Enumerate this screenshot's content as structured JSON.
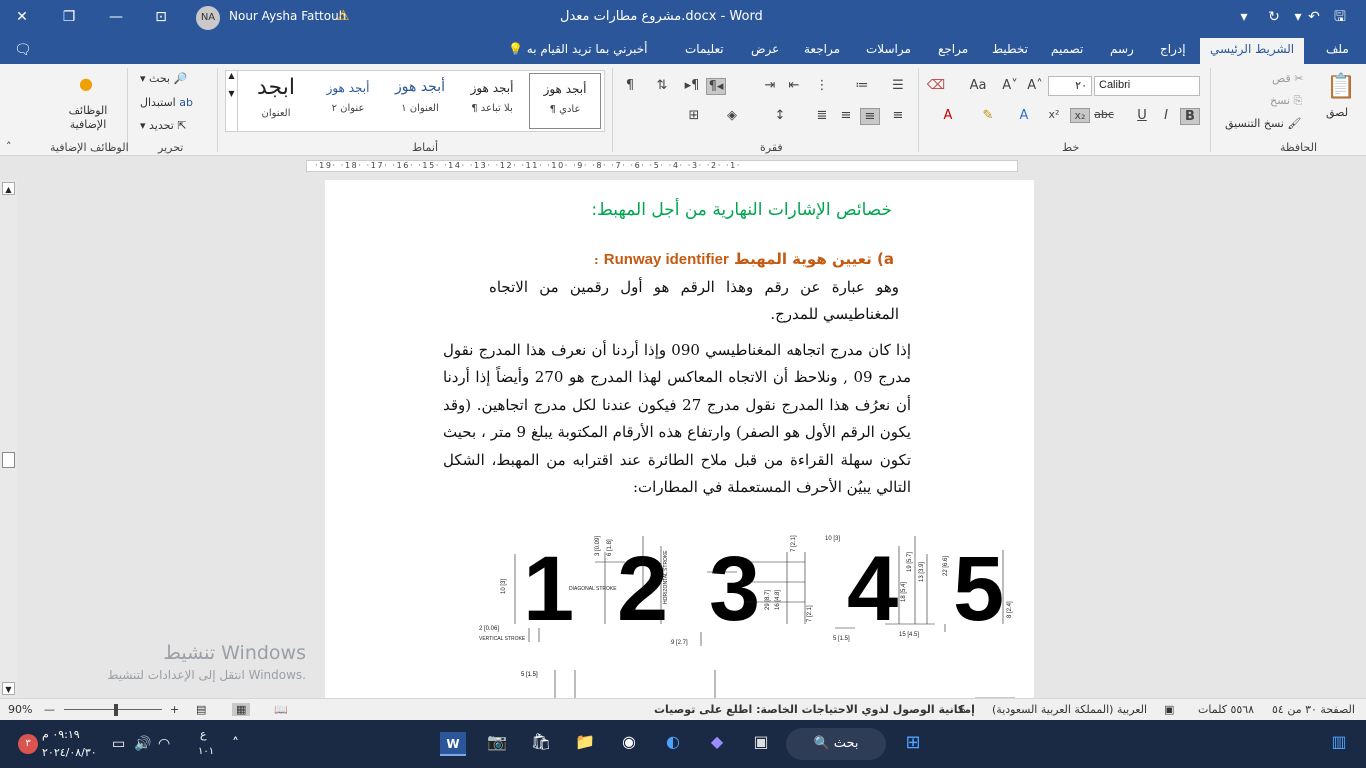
{
  "titlebar": {
    "title": "مشروع مطارات معدل.docx  -  Word",
    "user": "Nour Aysha Fattouh",
    "avatar_initials": "NA"
  },
  "tabs": {
    "file": "ملف",
    "home": "الشريط الرئيسي",
    "insert": "إدراج",
    "draw": "رسم",
    "design": "تصميم",
    "layout": "تخطيط",
    "references": "مراجع",
    "mailings": "مراسلات",
    "review": "مراجعة",
    "view": "عرض",
    "help": "تعليمات",
    "tell_me": "أخبرني بما تريد القيام به"
  },
  "ribbon": {
    "clipboard": {
      "label": "الحافظة",
      "paste": "لصق",
      "cut": "قص",
      "copy": "نسخ",
      "format_painter": "نسخ التنسيق"
    },
    "font": {
      "label": "خط",
      "font_name": "Calibri",
      "font_size": "٢٠"
    },
    "paragraph": {
      "label": "فقرة"
    },
    "styles": {
      "label": "أنماط",
      "items": [
        {
          "preview": "أبجد هوز",
          "name": "¶ عادي"
        },
        {
          "preview": "أبجد هوز",
          "name": "¶ بلا تباعد"
        },
        {
          "preview": "أبجد هوز",
          "name": "العنوان ١"
        },
        {
          "preview": "أبجد هوز",
          "name": "عنوان ٢"
        },
        {
          "preview": "ابجد",
          "name": "العنوان"
        }
      ]
    },
    "editing": {
      "label": "تحرير",
      "find": "بحث",
      "replace": "استبدال",
      "select": "تحديد"
    },
    "addins": {
      "label": "الوظائف الإضافية",
      "button": "الوظائف الإضافية"
    }
  },
  "ruler": {
    "marks": "·19·  ·18·  ·17·  ·16·  ·15·  ·14·  ·13·  ·12·  ·11·  ·10·  ·9·  ·8·  ·7·  ·6·  ·5·  ·4·  ·3·  ·2·  ·1·"
  },
  "document": {
    "heading": "خصائص الإشارات النهارية من أجل المهبط:",
    "subheading_prefix": "a) تعيين هوية المهبط",
    "subheading_latin": "Runway identifier",
    "subheading_suffix": ":",
    "para1": "وهو عبارة عن رقم وهذا الرقم هو أول رقمين من الاتجاه المغناطيسي للمدرج.",
    "para2": "إذا كان مدرج اتجاهه المغناطيسي 090 وإذا أردنا أن نعرف هذا المدرج نقول مدرج 09 , ونلاحظ أن الاتجاه المعاكس لهذا المدرج هو 270 وأيضاً إذا أردنا أن نعرُف هذا المدرج نقول مدرج 27 فيكون عندنا لكل مدرج اتجاهين. (وقد يكون الرقم الأول هو الصفر) وارتفاع هذه الأرقام المكتوبة يبلغ 9 متر ، بحيث تكون سهلة القراءة من قبل ملاح الطائرة عند اقترابه من المهبط، الشكل التالي يبيُن الأحرف المستعملة في المطارات:",
    "figure": {
      "digits": [
        "1",
        "2",
        "3",
        "4",
        "5"
      ],
      "labels": {
        "vertical_stroke": "VERTICAL STROKE",
        "diagonal_stroke": "DIAGONAL STROKE",
        "horizontal_stroke": "HORIZONTAL STROKE",
        "d1": "2 [0.06]",
        "d2": "10 [3]",
        "d3": "3 [0.09]",
        "d4": "6 [1.8]",
        "d5": "9 [2.7]",
        "d6": "7 [2.1]",
        "d7": "19 [5.7]",
        "d8": "22 [6.6]",
        "d9": "15 [4.5]",
        "d10": "5 [1.5]",
        "d11": "8 [2.4]",
        "d12": "13 [3.9]",
        "d13": "18 [5.4]",
        "d14": "29 [8.7]",
        "d15": "16 [4.8]",
        "d16": "5 [1.5]"
      }
    }
  },
  "watermark": {
    "title": "تنشيط Windows",
    "subtitle": "انتقل إلى الإعدادات لتنشيط Windows."
  },
  "statusbar": {
    "page": "الصفحة ٣٠ من ٥٤",
    "words": "٥٥٦٨ كلمات",
    "language": "العربية (المملكة العربية السعودية)",
    "accessibility": "إمكانية الوصول لذوي الاحتياجات الخاصة: اطلع على توصيات",
    "zoom": "90%"
  },
  "taskbar": {
    "search": "بحث",
    "time": "٠٩:١٩ م",
    "date": "٢٠٢٤/٠٨/٣٠",
    "lang": "ع",
    "lang2": "١٠١",
    "notif": "٣"
  },
  "colors": {
    "word_blue": "#2b579a",
    "heading_green": "#00a550",
    "sub_orange": "#c55a11"
  }
}
